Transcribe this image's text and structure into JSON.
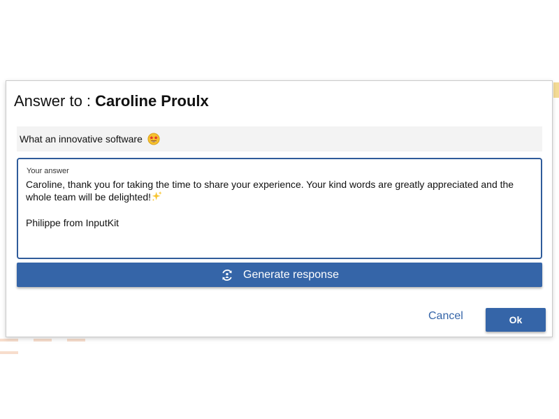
{
  "dialog": {
    "title_prefix": "Answer to : ",
    "title_name": "Caroline Proulx"
  },
  "review": {
    "text": "What an innovative software",
    "emoji_icon": "star-struck-face-icon"
  },
  "answer": {
    "label": "Your answer",
    "line1": "Caroline, thank you for taking the time to share your experience. Your kind words are greatly appreciated and the whole team will be delighted!",
    "line1_icon": "sparkles-icon",
    "signature": "Philippe from InputKit"
  },
  "actions": {
    "generate_label": "Generate response",
    "generate_icon": "ai-generate-icon",
    "cancel_label": "Cancel",
    "ok_label": "Ok"
  },
  "colors": {
    "accent": "#3565a8",
    "field_border": "#2f5b9a",
    "review_bg": "#f3f3f3"
  }
}
